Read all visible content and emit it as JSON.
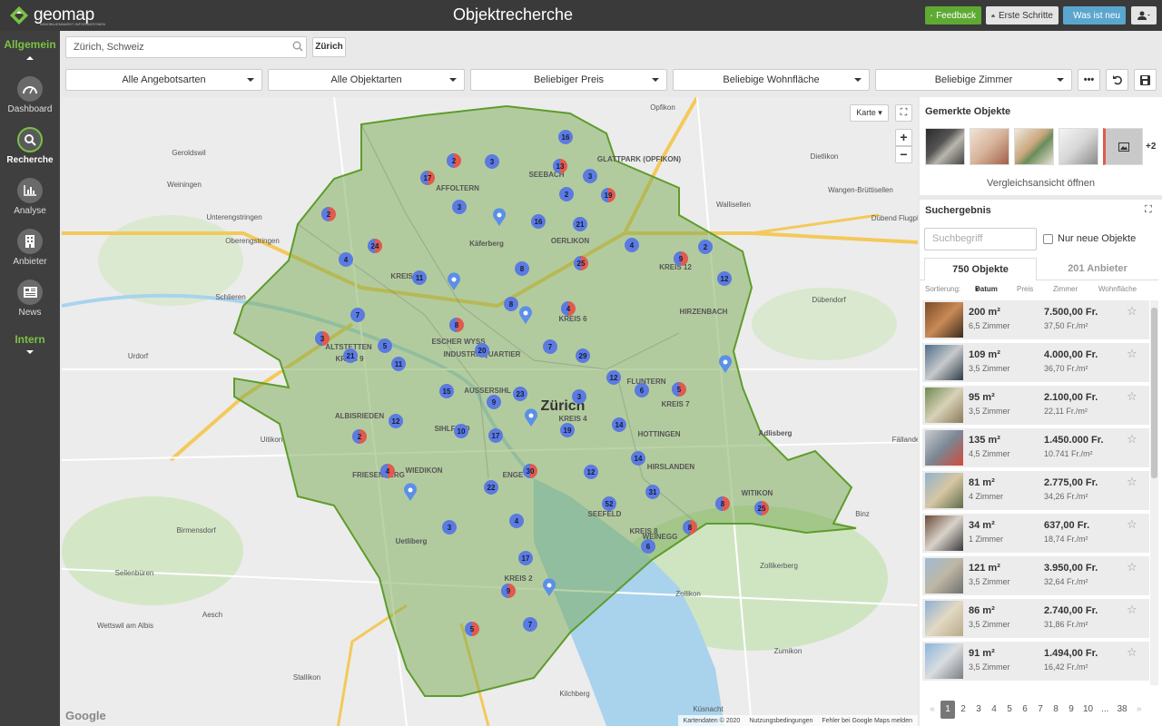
{
  "topbar": {
    "logo": "geomap",
    "logo_sub": "IMMOBILIENMARKT-INFORMATIONEN",
    "title": "Objektrecherche",
    "feedback": "Feedback",
    "first_steps": "Erste Schritte",
    "whats_new": "Was ist neu"
  },
  "sidebar": {
    "section_general": "Allgemein",
    "section_intern": "Intern",
    "items": [
      {
        "label": "Dashboard",
        "icon": "dashboard-icon"
      },
      {
        "label": "Recherche",
        "icon": "search-icon"
      },
      {
        "label": "Analyse",
        "icon": "chart-icon"
      },
      {
        "label": "Anbieter",
        "icon": "building-icon"
      },
      {
        "label": "News",
        "icon": "news-icon"
      }
    ]
  },
  "search": {
    "value": "Zürich, Schweiz",
    "button": "Zürich"
  },
  "filters": [
    "Alle Angebotsarten",
    "Alle Objektarten",
    "Beliebiger Preis",
    "Beliebige Wohnfläche",
    "Beliebige Zimmer"
  ],
  "filter_more": "•••",
  "map": {
    "type_button": "Karte",
    "zoom_in": "+",
    "zoom_out": "−",
    "google": "Google",
    "footer": [
      "Kartendaten © 2020",
      "Nutzungsbedingungen",
      "Fehler bei Google Maps melden"
    ],
    "district_labels": [
      "SEEBACH",
      "AFFOLTERN",
      "OERLIKON",
      "KREIS 11",
      "KREIS 12",
      "HIRZENBACH",
      "ALTSTETTEN",
      "KREIS 9",
      "ESCHER WYSS",
      "INDUSTRIEQUARTIER",
      "KREIS 6",
      "FLUNTERN",
      "KREIS 7",
      "AUSSERSIHL",
      "ALBISRIEDEN",
      "SIHLFELD",
      "HOTTINGEN",
      "KREIS 4",
      "HIRSLANDEN",
      "WIEDIKON",
      "ENGE",
      "FRIESENBERG",
      "SEEFELD",
      "KREIS 8",
      "WEINEGG",
      "WITIKON",
      "KREIS 2",
      "Zürich",
      "Käferberg",
      "Uetliberg",
      "Adlisberg",
      "GLATTPARK (OPFIKON)"
    ],
    "places": [
      "Opfikon",
      "Geroldswil",
      "Weiningen",
      "Unterengstringen",
      "Oberengstringen",
      "Schlieren",
      "Urdorf",
      "Uitikon",
      "Birmensdorf",
      "Dietlikon",
      "Wangen-Brüttisellen",
      "Wallisellen",
      "Dübendorf",
      "Dübend Flugpla",
      "Fällande",
      "Binz",
      "Zollikerberg",
      "Zollikon",
      "Zumikon",
      "Sellenbüren",
      "Wettswil am Albis",
      "Aesch",
      "Stallikon",
      "Kilchberg",
      "Küsnacht"
    ],
    "clusters": [
      {
        "n": "16",
        "t": "b"
      },
      {
        "n": "2",
        "t": "r"
      },
      {
        "n": "3",
        "t": "b"
      },
      {
        "n": "13",
        "t": "r"
      },
      {
        "n": "3",
        "t": "b"
      },
      {
        "n": "17",
        "t": "r"
      },
      {
        "n": "2",
        "t": "b"
      },
      {
        "n": "19",
        "t": "r"
      },
      {
        "n": "3",
        "t": "b"
      },
      {
        "n": "21",
        "t": "b"
      },
      {
        "n": "16",
        "t": "b"
      },
      {
        "n": "2",
        "t": "r"
      },
      {
        "n": "24",
        "t": "r"
      },
      {
        "n": "4",
        "t": "b"
      },
      {
        "n": "9",
        "t": "r"
      },
      {
        "n": "2",
        "t": "b"
      },
      {
        "n": "4",
        "t": "b"
      },
      {
        "n": "25",
        "t": "r"
      },
      {
        "n": "8",
        "t": "b"
      },
      {
        "n": "11",
        "t": "b"
      },
      {
        "n": "12",
        "t": "b"
      },
      {
        "n": "8",
        "t": "b"
      },
      {
        "n": "4",
        "t": "r"
      },
      {
        "n": "7",
        "t": "b"
      },
      {
        "n": "8",
        "t": "r"
      },
      {
        "n": "3",
        "t": "r"
      },
      {
        "n": "5",
        "t": "b"
      },
      {
        "n": "21",
        "t": "b"
      },
      {
        "n": "20",
        "t": "b"
      },
      {
        "n": "11",
        "t": "b"
      },
      {
        "n": "7",
        "t": "b"
      },
      {
        "n": "29",
        "t": "b"
      },
      {
        "n": "12",
        "t": "b"
      },
      {
        "n": "6",
        "t": "b"
      },
      {
        "n": "5",
        "t": "r"
      },
      {
        "n": "15",
        "t": "b"
      },
      {
        "n": "23",
        "t": "b"
      },
      {
        "n": "9",
        "t": "b"
      },
      {
        "n": "3",
        "t": "b"
      },
      {
        "n": "12",
        "t": "b"
      },
      {
        "n": "10",
        "t": "b"
      },
      {
        "n": "17",
        "t": "b"
      },
      {
        "n": "19",
        "t": "b"
      },
      {
        "n": "14",
        "t": "b"
      },
      {
        "n": "2",
        "t": "r"
      },
      {
        "n": "14",
        "t": "b"
      },
      {
        "n": "4",
        "t": "r"
      },
      {
        "n": "30",
        "t": "r"
      },
      {
        "n": "12",
        "t": "b"
      },
      {
        "n": "22",
        "t": "b"
      },
      {
        "n": "31",
        "t": "b"
      },
      {
        "n": "52",
        "t": "b"
      },
      {
        "n": "8",
        "t": "r"
      },
      {
        "n": "25",
        "t": "r"
      },
      {
        "n": "3",
        "t": "b"
      },
      {
        "n": "4",
        "t": "b"
      },
      {
        "n": "8",
        "t": "r"
      },
      {
        "n": "6",
        "t": "b"
      },
      {
        "n": "17",
        "t": "b"
      },
      {
        "n": "9",
        "t": "r"
      },
      {
        "n": "5",
        "t": "r"
      },
      {
        "n": "7",
        "t": "b"
      }
    ],
    "pins": 7
  },
  "saved": {
    "title": "Gemerkte Objekte",
    "more": "+2",
    "compare": "Vergleichsansicht öffnen"
  },
  "results": {
    "title": "Suchergebnis",
    "search_placeholder": "Suchbegriff",
    "only_new": "Nur neue Objekte",
    "tab_objects": "750 Objekte",
    "tab_providers": "201 Anbieter",
    "sort_label": "Sortierung:",
    "sort": [
      "Datum",
      "Preis",
      "Zimmer",
      "Wohnfläche"
    ],
    "rows": [
      {
        "area": "200 m²",
        "rooms": "6,5 Zimmer",
        "price": "7.500,00 Fr.",
        "ppm": "37,50 Fr./m²"
      },
      {
        "area": "109 m²",
        "rooms": "3,5 Zimmer",
        "price": "4.000,00 Fr.",
        "ppm": "36,70 Fr./m²"
      },
      {
        "area": "95 m²",
        "rooms": "3,5 Zimmer",
        "price": "2.100,00 Fr.",
        "ppm": "22,11 Fr./m²"
      },
      {
        "area": "135 m²",
        "rooms": "4,5 Zimmer",
        "price": "1.450.000 Fr.",
        "ppm": "10.741 Fr./m²"
      },
      {
        "area": "81 m²",
        "rooms": "4 Zimmer",
        "price": "2.775,00 Fr.",
        "ppm": "34,26 Fr./m²"
      },
      {
        "area": "34 m²",
        "rooms": "1 Zimmer",
        "price": "637,00 Fr.",
        "ppm": "18,74 Fr./m²"
      },
      {
        "area": "121 m²",
        "rooms": "3,5 Zimmer",
        "price": "3.950,00 Fr.",
        "ppm": "32,64 Fr./m²"
      },
      {
        "area": "86 m²",
        "rooms": "3,5 Zimmer",
        "price": "2.740,00 Fr.",
        "ppm": "31,86 Fr./m²"
      },
      {
        "area": "91 m²",
        "rooms": "3,5 Zimmer",
        "price": "1.494,00 Fr.",
        "ppm": "16,42 Fr./m²"
      }
    ],
    "pages": [
      "«",
      "1",
      "2",
      "3",
      "4",
      "5",
      "6",
      "7",
      "8",
      "9",
      "10",
      "...",
      "38",
      "»"
    ]
  },
  "colors": {
    "accent": "#7bc143",
    "topbar": "#3a3a3a",
    "cluster_blue": "#5b7be0",
    "cluster_red": "#e05a4f"
  }
}
